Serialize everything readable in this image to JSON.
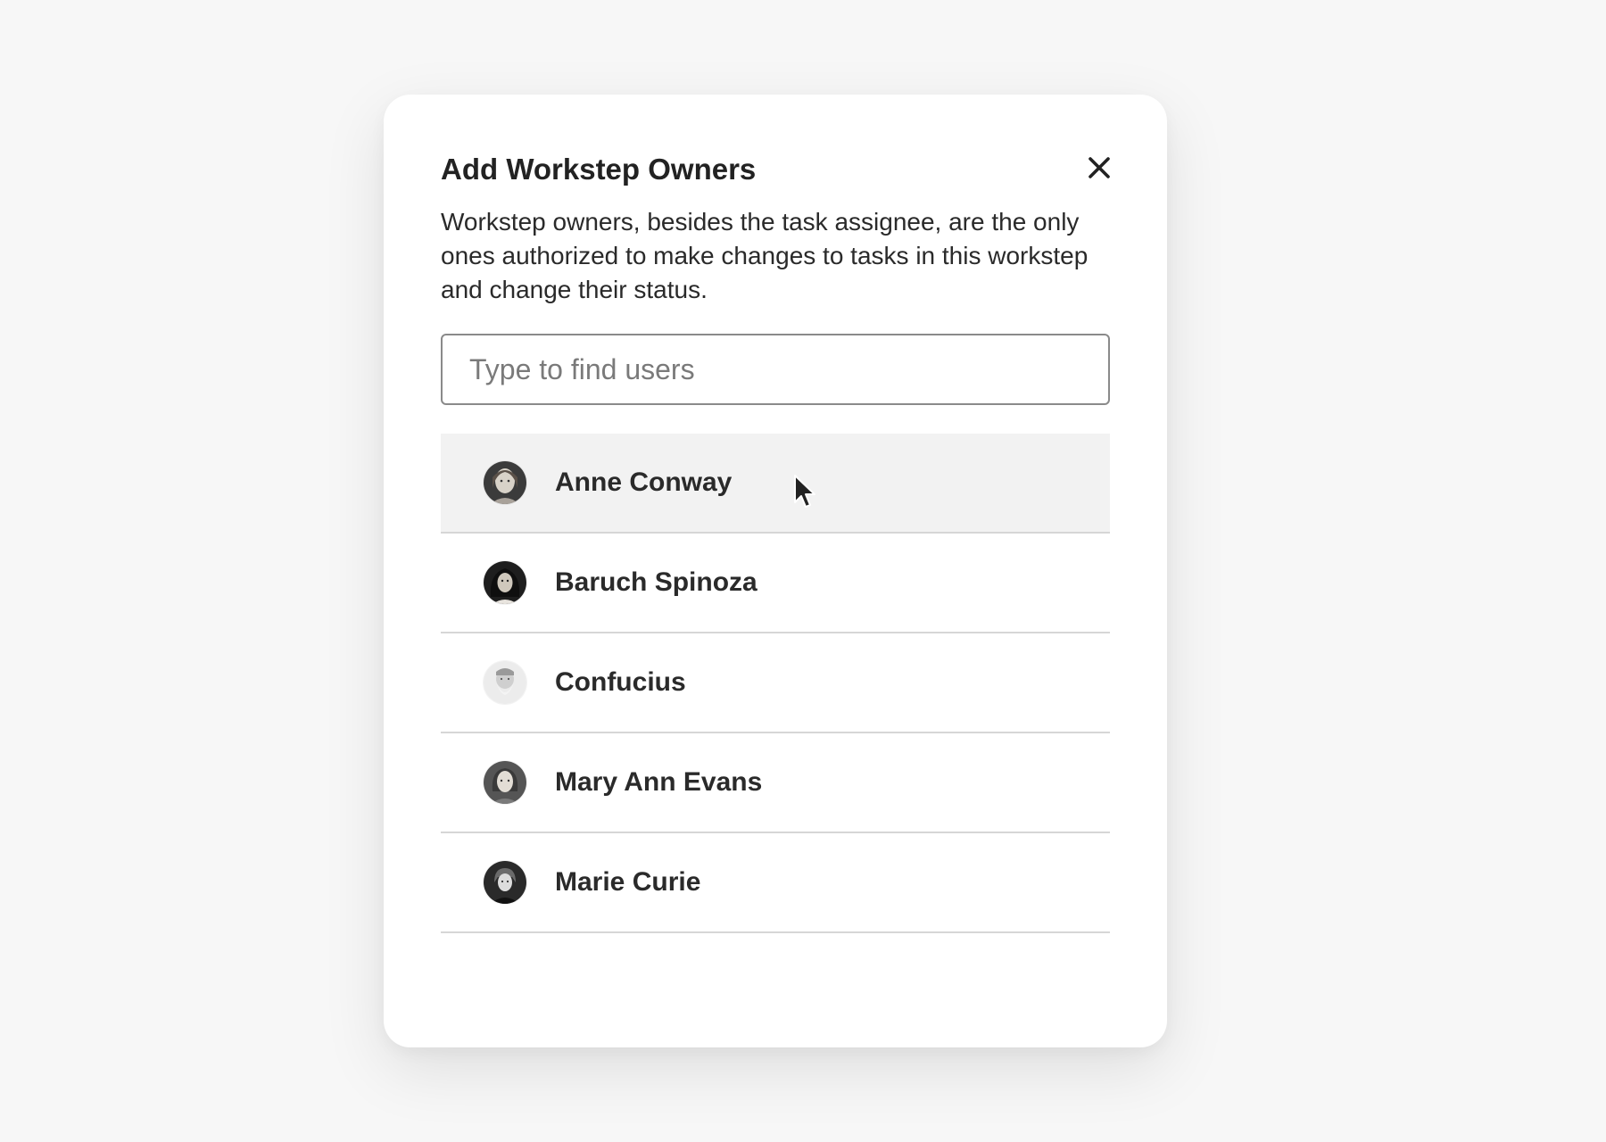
{
  "dialog": {
    "title": "Add Workstep Owners",
    "description": "Workstep owners, besides the task assignee, are the only ones authorized to make changes to tasks in this workstep and change their status.",
    "close_icon": "close-icon"
  },
  "search": {
    "placeholder": "Type to find users",
    "value": ""
  },
  "users": [
    {
      "name": "Anne Conway",
      "avatar_icon": "avatar-portrait-icon",
      "hovered": true
    },
    {
      "name": "Baruch Spinoza",
      "avatar_icon": "avatar-portrait-icon",
      "hovered": false
    },
    {
      "name": "Confucius",
      "avatar_icon": "avatar-portrait-icon",
      "hovered": false
    },
    {
      "name": "Mary Ann Evans",
      "avatar_icon": "avatar-portrait-icon",
      "hovered": false
    },
    {
      "name": "Marie Curie",
      "avatar_icon": "avatar-portrait-icon",
      "hovered": false
    }
  ],
  "colors": {
    "background": "#f7f7f7",
    "modal": "#ffffff",
    "text": "#222222",
    "hover_row": "#f2f2f2",
    "divider": "#d6d6d6",
    "input_border": "#8a8a8a"
  },
  "pointer_icon": "mouse-pointer-icon"
}
